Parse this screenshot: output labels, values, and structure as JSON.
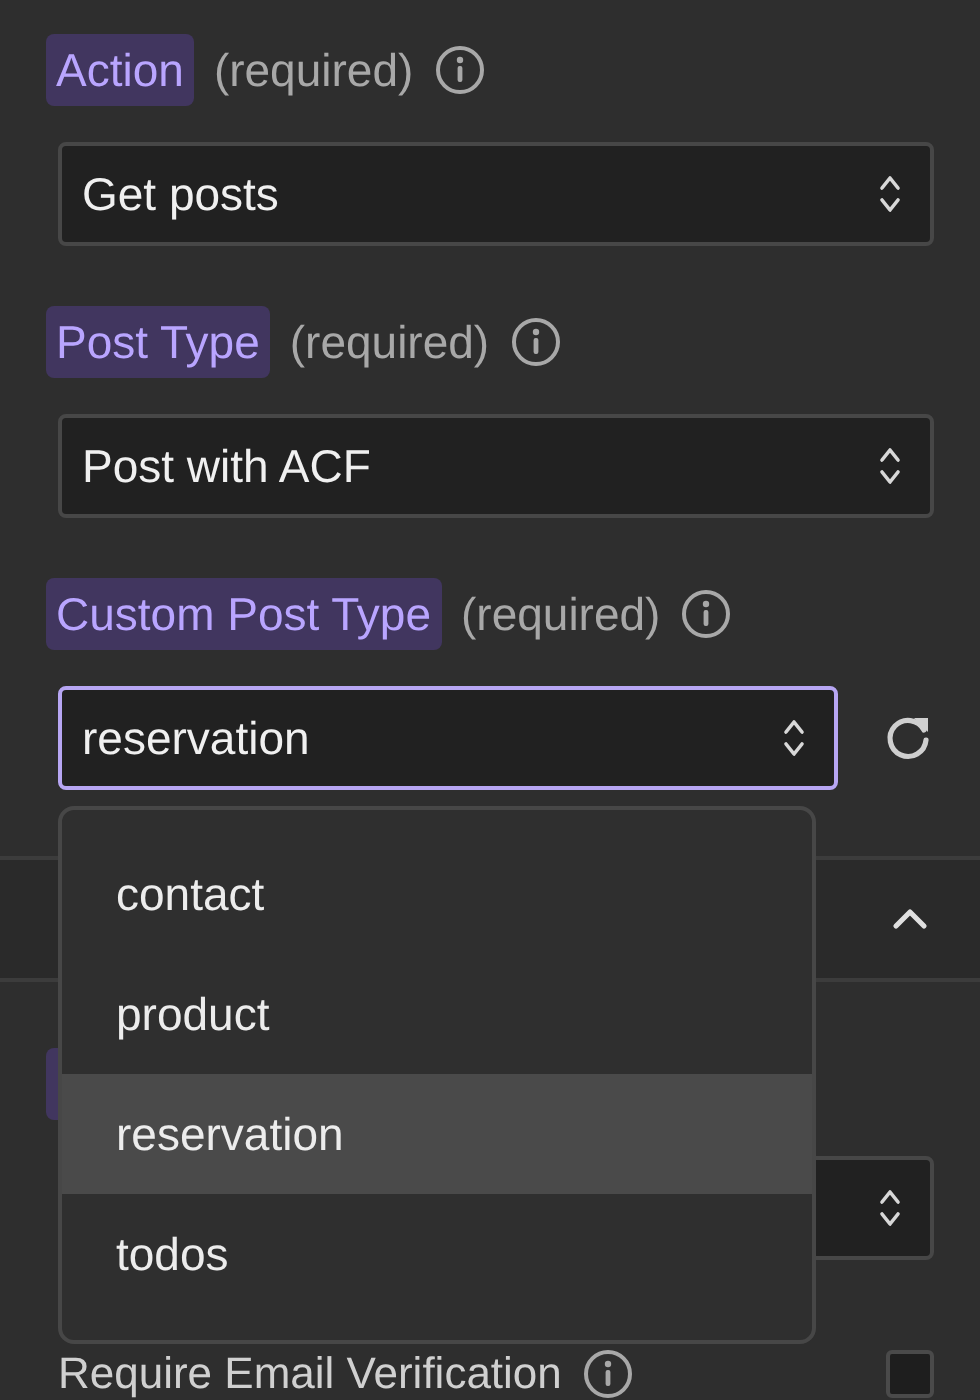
{
  "fields": [
    {
      "label": "Action",
      "required": "(required)",
      "value": "Get posts",
      "focused": false,
      "refresh": false
    },
    {
      "label": "Post Type",
      "required": "(required)",
      "value": "Post with ACF",
      "focused": false,
      "refresh": false
    },
    {
      "label": "Custom Post Type",
      "required": "(required)",
      "value": "reservation",
      "focused": true,
      "refresh": true
    }
  ],
  "section": {
    "expanded": true
  },
  "lower_fields": [
    {
      "label": "Require Email Verification",
      "checked": false
    }
  ],
  "dropdown": {
    "options": [
      {
        "label": "contact",
        "selected": false
      },
      {
        "label": "product",
        "selected": false
      },
      {
        "label": "reservation",
        "selected": true
      },
      {
        "label": "todos",
        "selected": false
      }
    ]
  }
}
